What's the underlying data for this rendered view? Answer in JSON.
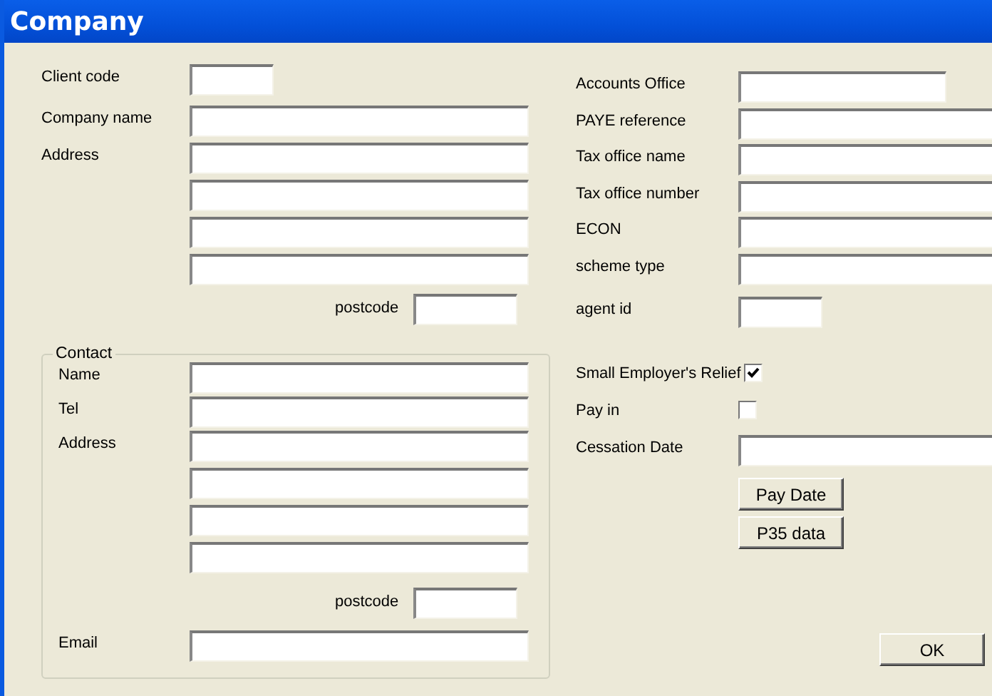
{
  "window": {
    "title": "Company"
  },
  "company_fields": [
    {
      "label": "Client code",
      "kind": "short"
    },
    {
      "label": "Company name",
      "kind": "long"
    },
    {
      "label": "Address",
      "kind": "long"
    },
    {
      "kind": "long"
    },
    {
      "kind": "long"
    },
    {
      "kind": "long"
    }
  ],
  "company_postcode": {
    "label": "postcode"
  },
  "contact": {
    "title": "Contact",
    "fields": [
      {
        "label": "Name",
        "kind": "long"
      },
      {
        "label": "Tel",
        "kind": "long"
      },
      {
        "label": "Address",
        "kind": "long"
      },
      {
        "kind": "long"
      },
      {
        "kind": "long"
      },
      {
        "kind": "long"
      }
    ],
    "postcode": {
      "label": "postcode"
    },
    "email": {
      "label": "Email"
    }
  },
  "tax_fields": [
    {
      "label": "Accounts Office",
      "kind": "medium"
    },
    {
      "label": "PAYE reference",
      "kind": "wide"
    },
    {
      "label": "Tax office name",
      "kind": "wide"
    },
    {
      "label": "Tax office number",
      "kind": "wide"
    },
    {
      "label": "ECON",
      "kind": "wide"
    },
    {
      "label": "scheme type",
      "kind": "wide"
    },
    {
      "label": "agent id",
      "kind": "short"
    }
  ],
  "options": [
    {
      "label": "Small Employer's Relief",
      "checked": true
    },
    {
      "label": "Pay in",
      "checked": false
    }
  ],
  "cessation": {
    "label": "Cessation Date"
  },
  "buttons": [
    "Pay Date",
    "P35 data"
  ],
  "ok": "OK"
}
